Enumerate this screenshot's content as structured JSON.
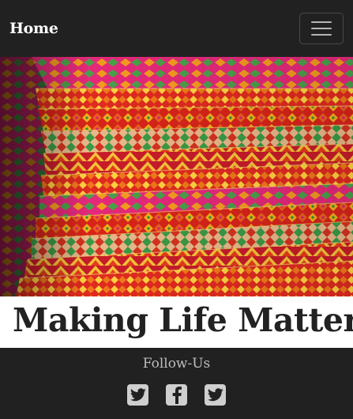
{
  "navbar": {
    "brand": "Home",
    "toggle_icon": "hamburger-menu-icon"
  },
  "hero": {
    "image_description": "stack of colorful embroidered phulkari fabrics"
  },
  "tagline": "Making Life Matter",
  "footer": {
    "follow_label": "Follow-Us",
    "social": [
      {
        "icon": "twitter-icon"
      },
      {
        "icon": "facebook-icon"
      },
      {
        "icon": "twitter-icon"
      }
    ]
  },
  "colors": {
    "navbar_bg": "#212121",
    "footer_bg": "#212121",
    "tagline_bg": "#ffffff",
    "text_dark": "#222222",
    "icon": "#cfcfcf"
  }
}
